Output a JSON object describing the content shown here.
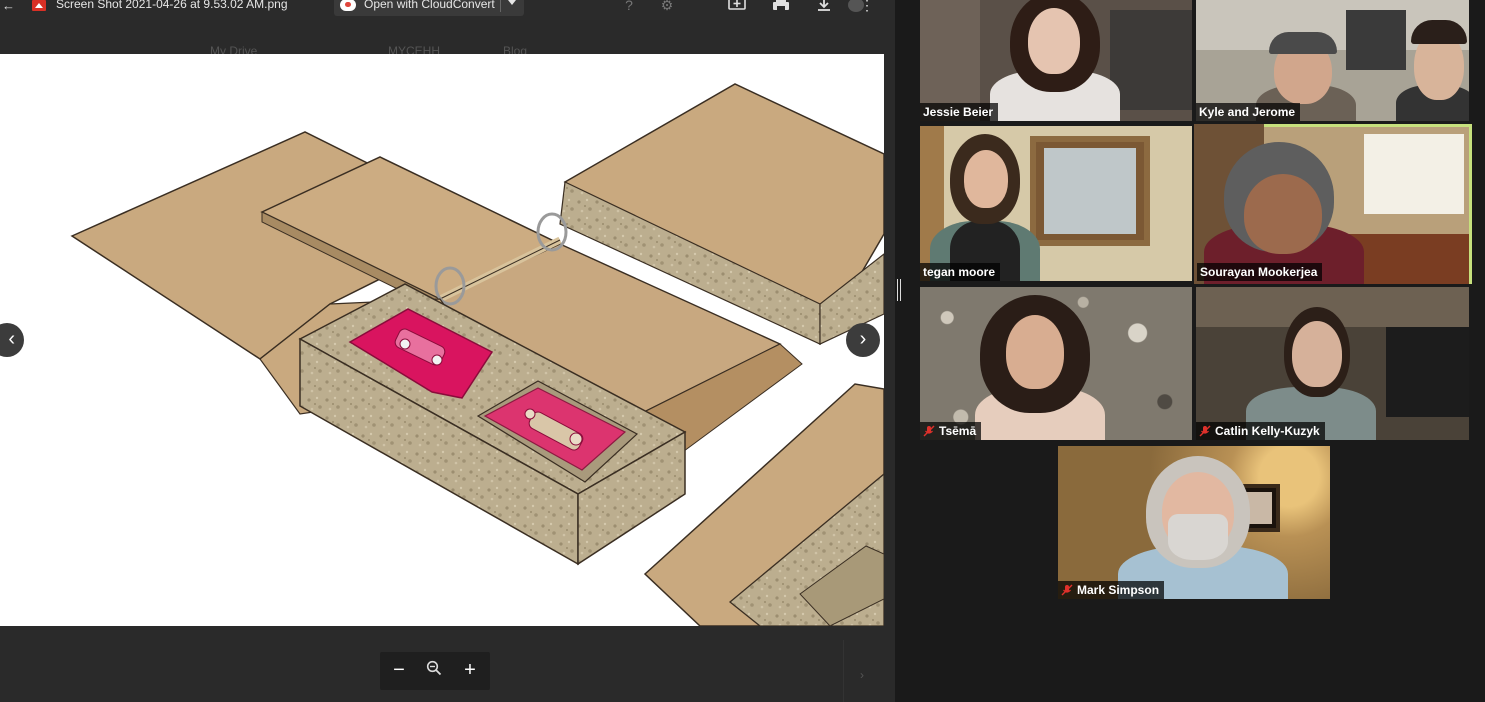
{
  "viewer": {
    "file_name": "Screen Shot 2021-04-26 at 9.53.02 AM.png",
    "open_with_label": "Open with CloudConvert",
    "ghost_toolbar": [
      "My Drive",
      "MYCEHH",
      "Blog"
    ],
    "zoom": {
      "minus": "−",
      "plus": "+"
    },
    "nav": {
      "prev": "‹",
      "next": "›"
    }
  },
  "participants": [
    {
      "name": "Jessie Beier",
      "muted": false,
      "active": false
    },
    {
      "name": "Kyle and Jerome",
      "muted": false,
      "active": false
    },
    {
      "name": "tegan moore",
      "muted": false,
      "active": false
    },
    {
      "name": "Sourayan Mookerjea",
      "muted": false,
      "active": true
    },
    {
      "name": "Tsēmā",
      "muted": true,
      "active": false
    },
    {
      "name": "Catlin Kelly-Kuzyk",
      "muted": true,
      "active": false
    },
    {
      "name": "Mark Simpson",
      "muted": true,
      "active": false
    }
  ],
  "colors": {
    "active_speaker_border": "#c6e07d",
    "cassette": "#d9145f",
    "cardboard": "#c7a77d",
    "foam": "#b8a98a"
  },
  "icons": [
    "back-arrow-icon",
    "image-file-icon",
    "cloudconvert-icon",
    "help-icon",
    "gear-icon",
    "add-comment-icon",
    "print-icon",
    "download-icon",
    "more-vert-icon",
    "zoom-icon",
    "mic-muted-icon"
  ]
}
